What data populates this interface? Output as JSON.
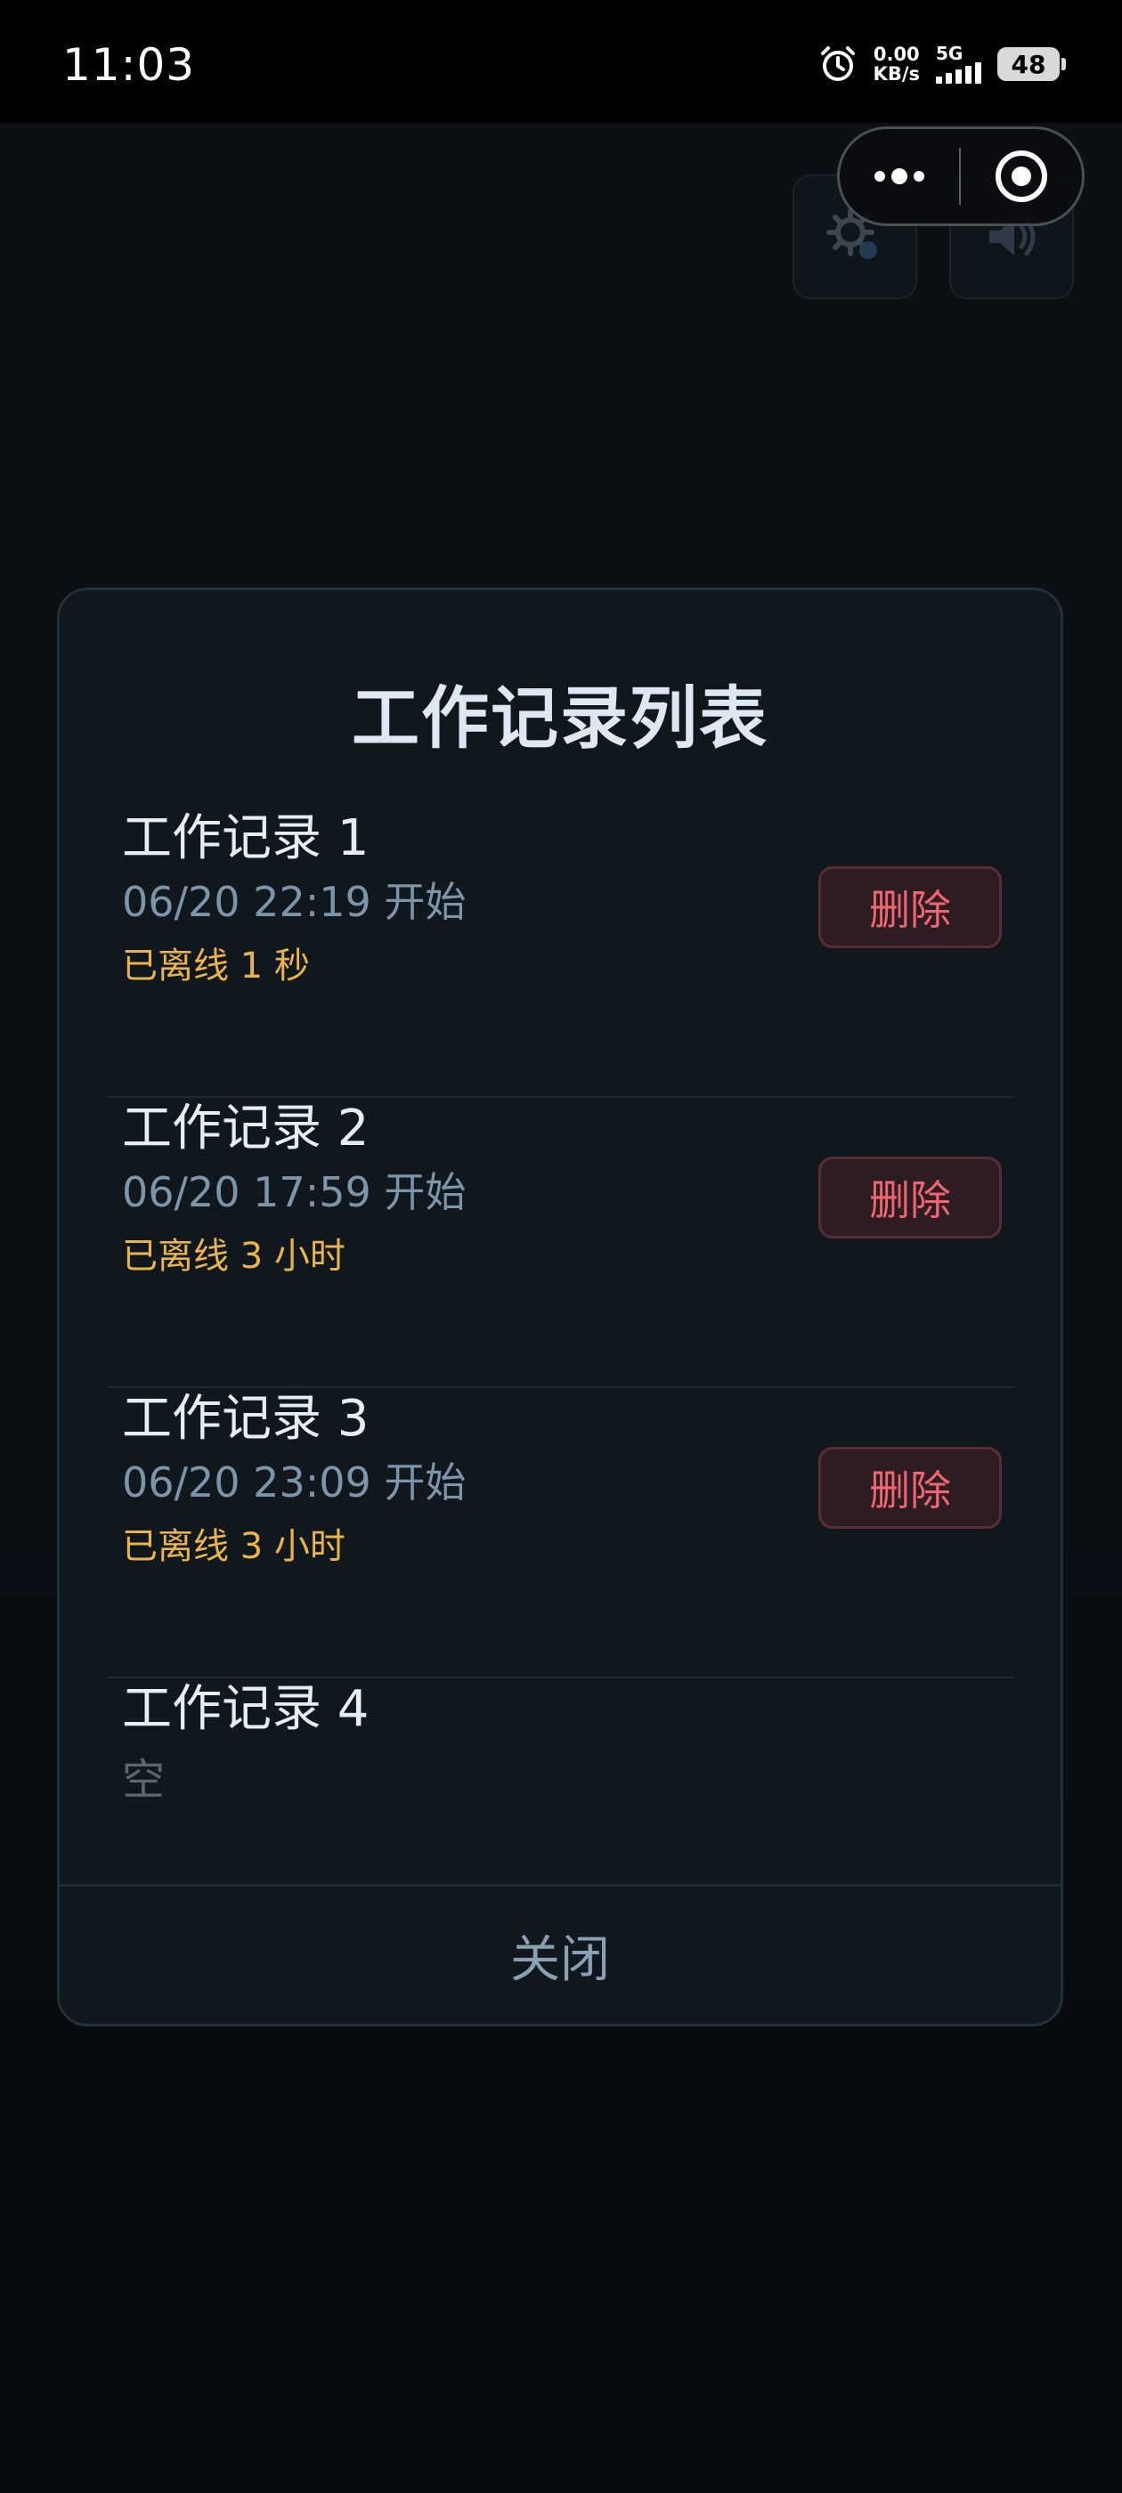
{
  "status_bar": {
    "time": "11:03",
    "net_speed_value": "0.00",
    "net_speed_unit": "KB/s",
    "network_type": "5G",
    "battery": "48",
    "icons": [
      "alarm-icon",
      "signal-icon",
      "battery-icon"
    ]
  },
  "background": {
    "buttons": [
      {
        "icon": "settings-icon"
      },
      {
        "icon": "speaker-icon"
      }
    ]
  },
  "capsule": {
    "more_icon": "more-icon",
    "close_icon": "close-target-icon"
  },
  "modal": {
    "title": "工作记录列表",
    "records": [
      {
        "name": "工作记录 1",
        "start": "06/20 22:19 开始",
        "status": "已离线 1 秒",
        "delete_label": "删除"
      },
      {
        "name": "工作记录 2",
        "start": "06/20 17:59 开始",
        "status": "已离线 3 小时",
        "delete_label": "删除"
      },
      {
        "name": "工作记录 3",
        "start": "06/20 23:09 开始",
        "status": "已离线 3 小时",
        "delete_label": "删除"
      },
      {
        "name": "工作记录 4",
        "empty": "空"
      }
    ],
    "close_label": "关闭"
  },
  "colors": {
    "accent_status": "#e9b44c",
    "delete_text": "#ef6670",
    "title": "#dde8f3"
  }
}
